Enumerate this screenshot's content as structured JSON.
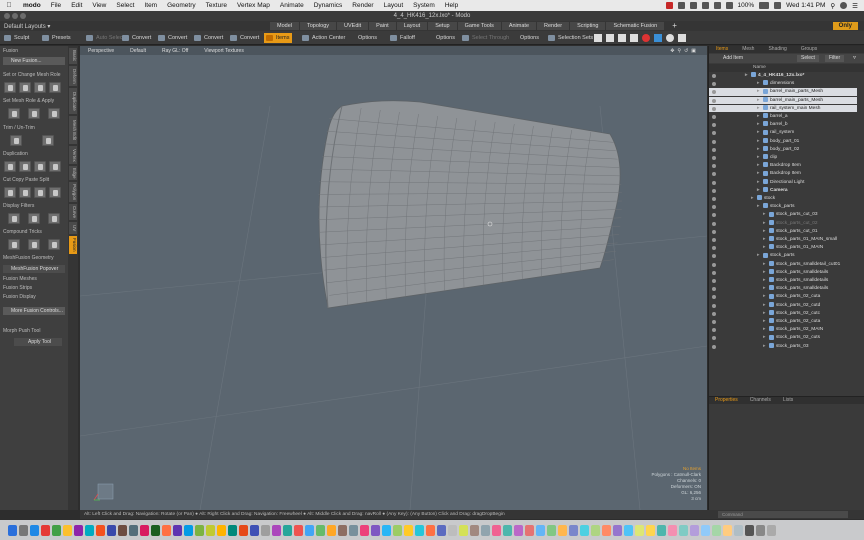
{
  "menubar": {
    "app": "modo",
    "items": [
      "File",
      "Edit",
      "View",
      "Select",
      "Item",
      "Geometry",
      "Texture",
      "Vertex Map",
      "Animate",
      "Dynamics",
      "Render",
      "Layout",
      "System",
      "Help"
    ],
    "battery": "100%",
    "clock": "Wed 1:41 PM"
  },
  "window": {
    "title": "4_4_HK416_12x.lxo* - Modo"
  },
  "layout_bar": {
    "layout": "Default Layouts ▾",
    "tabs": [
      "Model",
      "Topology",
      "UVEdit",
      "Paint",
      "Layout",
      "Setup",
      "Game Tools",
      "Animate",
      "Render",
      "Scripting",
      "Schematic Fusion",
      "+"
    ],
    "only": "Only"
  },
  "toolbar": {
    "sculpt": "Sculpt",
    "presets": "Presets",
    "items": [
      "Auto Select",
      "Convert",
      "Convert",
      "Convert",
      "Convert",
      "Items",
      "Action Center",
      "Options",
      "Falloff",
      "Options",
      "Select Through",
      "Options",
      "Selection Sets"
    ]
  },
  "left_panel": {
    "fusion_head": "Fusion",
    "new_fusion": "New Fusion...",
    "sections": [
      "Set or Change Mesh Role",
      "Set Mesh Role & Apply",
      "Trim / Un-Trim",
      "Duplication",
      "Cut Copy Paste Split",
      "Display Filters",
      "Compound Tricks",
      "MeshFusion Geometry"
    ],
    "popover": "MeshFusion Popover",
    "collapsed": [
      "Fusion Meshes",
      "Fusion Strips",
      "Fusion Display"
    ],
    "more": "More Fusion Controls...",
    "morph_head": "Morph Push Tool",
    "apply": "Apply Tool"
  },
  "vtabs": [
    "Basic",
    "Deform",
    "Duplicate",
    "Mesh Edit",
    "Vertex",
    "Edge",
    "Polygon",
    "Curve",
    "UV",
    "Fusion"
  ],
  "viewport": {
    "header": [
      "Perspective",
      "Default",
      "Ray GL: Off",
      "Viewport Textures"
    ],
    "info": {
      "warn": "No Items",
      "lines": [
        "Polygons : Catmull-Clark",
        "Channels: 0",
        "Deformers: ON",
        "GL: 6,256",
        "3 cm"
      ]
    }
  },
  "right_panel": {
    "tabs": [
      "Items",
      "Mesh",
      "Shading",
      "Groups"
    ],
    "add_item": "Add Item",
    "select": "Select",
    "filter": "Filter",
    "column": "Name",
    "rows": [
      {
        "label": "4_4_HK416_12x.lxo*",
        "indent": 0,
        "style": "bold"
      },
      {
        "label": "dimensions",
        "indent": 2,
        "style": ""
      },
      {
        "label": "barrel_main_parts_Mesh",
        "indent": 2,
        "style": "sel"
      },
      {
        "label": "barrel_main_parts_Mesh",
        "indent": 2,
        "style": "sel"
      },
      {
        "label": "rail_system_main Mesh",
        "indent": 2,
        "style": "sel"
      },
      {
        "label": "barrel_a",
        "indent": 2,
        "style": ""
      },
      {
        "label": "barrel_b",
        "indent": 2,
        "style": ""
      },
      {
        "label": "rail_system",
        "indent": 2,
        "style": ""
      },
      {
        "label": "body_part_01",
        "indent": 2,
        "style": ""
      },
      {
        "label": "body_part_02",
        "indent": 2,
        "style": ""
      },
      {
        "label": "clip",
        "indent": 2,
        "style": ""
      },
      {
        "label": "Backdrop Item",
        "indent": 2,
        "style": ""
      },
      {
        "label": "Backdrop Item",
        "indent": 2,
        "style": ""
      },
      {
        "label": "Directional Light",
        "indent": 2,
        "style": ""
      },
      {
        "label": "Camera",
        "indent": 2,
        "style": "bold"
      },
      {
        "label": "stock",
        "indent": 1,
        "style": ""
      },
      {
        "label": "stock_parts",
        "indent": 2,
        "style": ""
      },
      {
        "label": "stock_parts_cut_03",
        "indent": 3,
        "style": ""
      },
      {
        "label": "stock_parts_cut_02",
        "indent": 3,
        "style": "dim"
      },
      {
        "label": "stock_parts_cut_01",
        "indent": 3,
        "style": ""
      },
      {
        "label": "stock_parts_01_MAIN_small",
        "indent": 3,
        "style": ""
      },
      {
        "label": "stock_parts_01_MAIN",
        "indent": 3,
        "style": ""
      },
      {
        "label": "stock_parts",
        "indent": 2,
        "style": ""
      },
      {
        "label": "stock_parts_smalldetail_cut01",
        "indent": 3,
        "style": ""
      },
      {
        "label": "stock_parts_smalldetails",
        "indent": 3,
        "style": ""
      },
      {
        "label": "stock_parts_smalldetails",
        "indent": 3,
        "style": ""
      },
      {
        "label": "stock_parts_smalldetails",
        "indent": 3,
        "style": ""
      },
      {
        "label": "stock_parts_02_cuta",
        "indent": 3,
        "style": ""
      },
      {
        "label": "stock_parts_02_cutd",
        "indent": 3,
        "style": ""
      },
      {
        "label": "stock_parts_02_cutc",
        "indent": 3,
        "style": ""
      },
      {
        "label": "stock_parts_02_cuta",
        "indent": 3,
        "style": ""
      },
      {
        "label": "stock_parts_02_MAIN",
        "indent": 3,
        "style": ""
      },
      {
        "label": "stock_parts_02_cuts",
        "indent": 3,
        "style": ""
      },
      {
        "label": "stock_parts_03",
        "indent": 3,
        "style": ""
      }
    ],
    "props_tabs": [
      "Properties",
      "Channels",
      "Lists"
    ]
  },
  "statusbar": {
    "text": "Alt: Left Click and Drag: Navigation: Rotate (or Pan) ● Alt: Right Click and Drag: Navigation: Freewheel ● Alt: Middle Click and Drag: navRoll ● (Any Key): (Any Button) Click and Drag: dragDropBegin",
    "command": "Command"
  },
  "colors": {
    "accent": "#e89a16",
    "viewport": "#5b6670",
    "mesh": "#8e9296"
  }
}
